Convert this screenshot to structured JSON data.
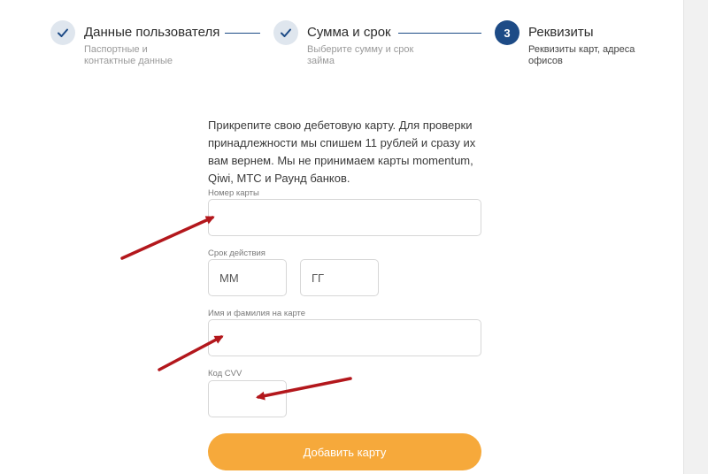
{
  "stepper": {
    "steps": [
      {
        "number": "1",
        "state": "done",
        "title": "Данные пользователя",
        "subtitle": "Паспортные и контактные данные"
      },
      {
        "number": "2",
        "state": "done",
        "title": "Сумма и срок",
        "subtitle": "Выберите сумму и срок займа"
      },
      {
        "number": "3",
        "state": "active",
        "title": "Реквизиты",
        "subtitle": "Реквизиты карт, адреса офисов"
      }
    ]
  },
  "form": {
    "intro": "Прикрепите свою дебетовую карту. Для проверки принадлежности мы спишем 11 рублей и сразу их вам вернем. Мы не принимаем карты momentum, Qiwi, МТС и Раунд банков.",
    "card_number": {
      "label": "Номер карты",
      "value": "",
      "placeholder": ""
    },
    "expiry": {
      "label": "Срок действия",
      "month_placeholder": "ММ",
      "year_placeholder": "ГГ"
    },
    "cardholder": {
      "label": "Имя и фамилия на карте",
      "value": "",
      "placeholder": ""
    },
    "cvv": {
      "label": "Код CVV",
      "value": "",
      "placeholder": ""
    },
    "submit_label": "Добавить карту"
  },
  "colors": {
    "accent": "#1d4b86",
    "button": "#f6a93b",
    "annotation_arrow": "#b3171c"
  }
}
